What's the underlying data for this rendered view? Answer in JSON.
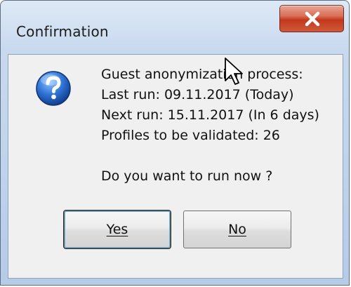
{
  "window": {
    "title": "Confirmation",
    "close_icon": "close-icon"
  },
  "message": {
    "icon": "question-icon",
    "lines": [
      "Guest anonymization process:",
      "Last run: 09.11.2017 (Today)",
      "Next run: 15.11.2017 (In 6 days)",
      "Profiles to be validated: 26"
    ],
    "question": "Do you want to run now ?"
  },
  "buttons": {
    "yes_label": "Yes",
    "no_label": "No"
  },
  "colors": {
    "close_button": "#c2391d",
    "question_icon": "#1f5fbf",
    "client_background": "#f0f0f0"
  }
}
